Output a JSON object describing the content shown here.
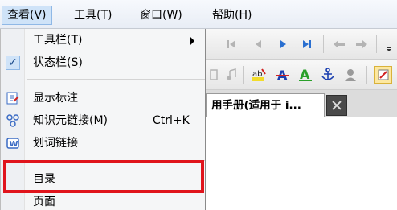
{
  "menubar": {
    "items": [
      {
        "label": "查看(V)"
      },
      {
        "label": "工具(T)"
      },
      {
        "label": "窗口(W)"
      },
      {
        "label": "帮助(H)"
      }
    ]
  },
  "toolbar": {
    "icons": [
      "first-page-icon",
      "prev-page-icon",
      "next-page-icon",
      "last-page-icon",
      "back-icon",
      "forward-icon",
      "text-color-icon",
      "font-color-icon",
      "outline-font-icon",
      "anchor-icon",
      "link-icon",
      "edit-icon"
    ]
  },
  "tab": {
    "title": "用手册(适用于 i..."
  },
  "menu": {
    "items": [
      {
        "label": "工具栏(T)",
        "has_submenu": true
      },
      {
        "label": "状态栏(S)",
        "checked": true
      },
      {
        "label": "显示标注",
        "icon": "annotation-icon"
      },
      {
        "label": "知识元链接(M)",
        "shortcut": "Ctrl+K",
        "icon": "knowledge-link-icon"
      },
      {
        "label": "划词链接",
        "icon": "word-link-icon"
      },
      {
        "label": "目录"
      },
      {
        "label": "页面"
      }
    ],
    "check_glyph": "✓"
  },
  "highlight_color": "#e0141c"
}
